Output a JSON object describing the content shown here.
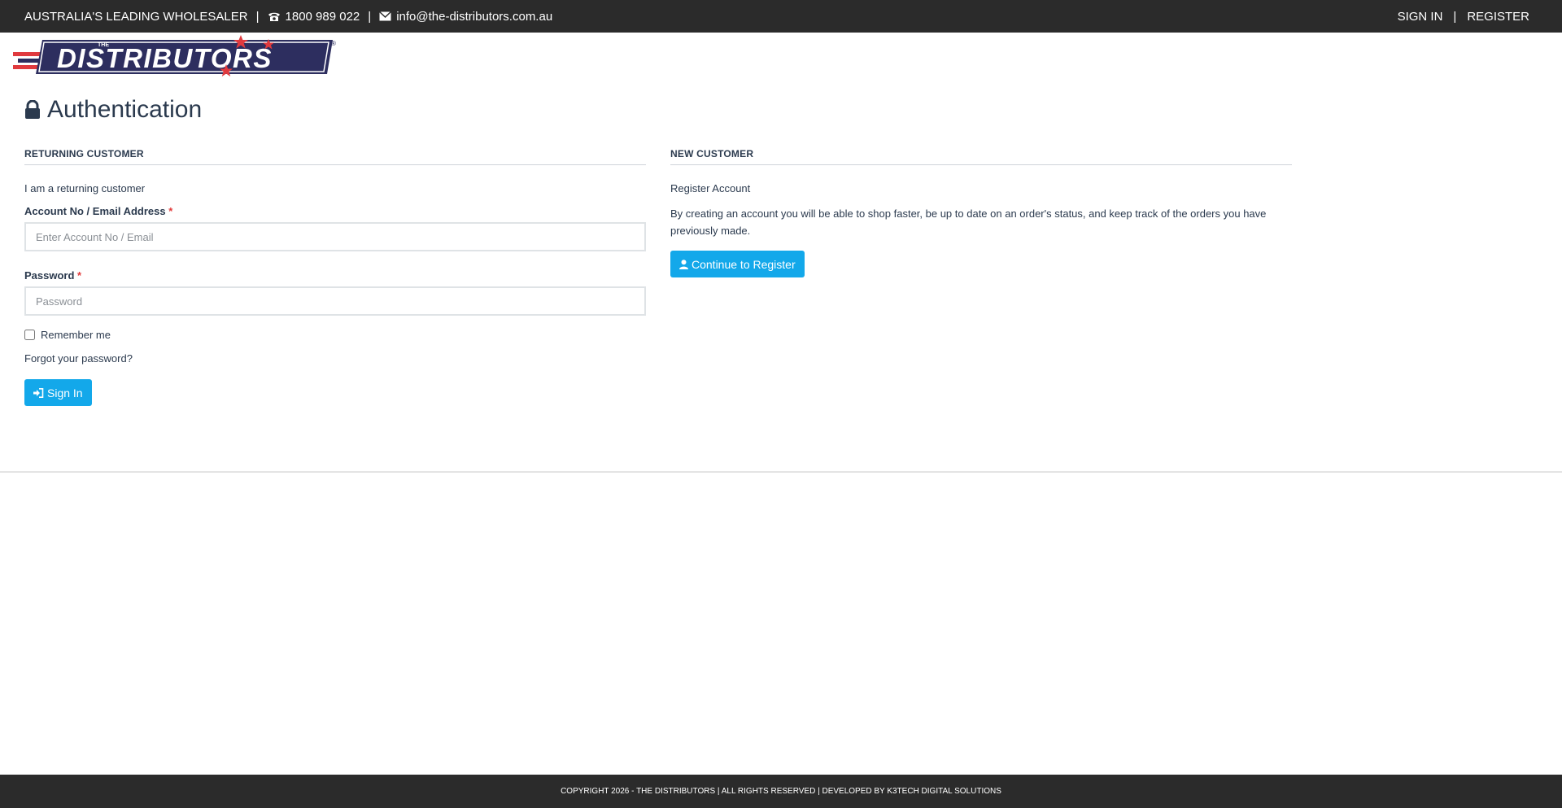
{
  "topbar": {
    "tagline": "AUSTRALIA'S LEADING WHOLESALER",
    "separator": "|",
    "phone": "1800 989 022",
    "email": "info@the-distributors.com.au",
    "phone_icon": "phone-icon",
    "email_icon": "envelope-icon",
    "sign_in": "SIGN IN",
    "register": "REGISTER"
  },
  "logo": {
    "small_text": "THE",
    "main_text": "DISTRIBUTORS",
    "registered": "®",
    "colors": {
      "navy": "#2d2e5f",
      "red": "#e03a3e"
    }
  },
  "page": {
    "title": "Authentication",
    "title_icon": "lock-icon"
  },
  "returning": {
    "heading": "RETURNING CUSTOMER",
    "intro": "I am a returning customer",
    "account_label": "Account No / Email Address",
    "required_mark": "*",
    "account_placeholder": "Enter Account No / Email",
    "password_label": "Password",
    "password_placeholder": "Password",
    "remember_label": "Remember me",
    "forgot_link": "Forgot your password?",
    "sign_in_button": "Sign In",
    "sign_in_icon": "sign-in-icon"
  },
  "new_customer": {
    "heading": "NEW CUSTOMER",
    "subheading": "Register Account",
    "description": "By creating an account you will be able to shop faster, be up to date on an order's status, and keep track of the orders you have previously made.",
    "register_button": "Continue to Register",
    "register_icon": "user-icon"
  },
  "footer": {
    "text": "COPYRIGHT 2026 - THE DISTRIBUTORS | ALL RIGHTS RESERVED | DEVELOPED BY K3TECH DIGITAL SOLUTIONS"
  },
  "colors": {
    "topbar_bg": "#2b2b2b",
    "accent_button": "#13a8ea",
    "text": "#2b3a4e",
    "required": "#e23b3b"
  }
}
